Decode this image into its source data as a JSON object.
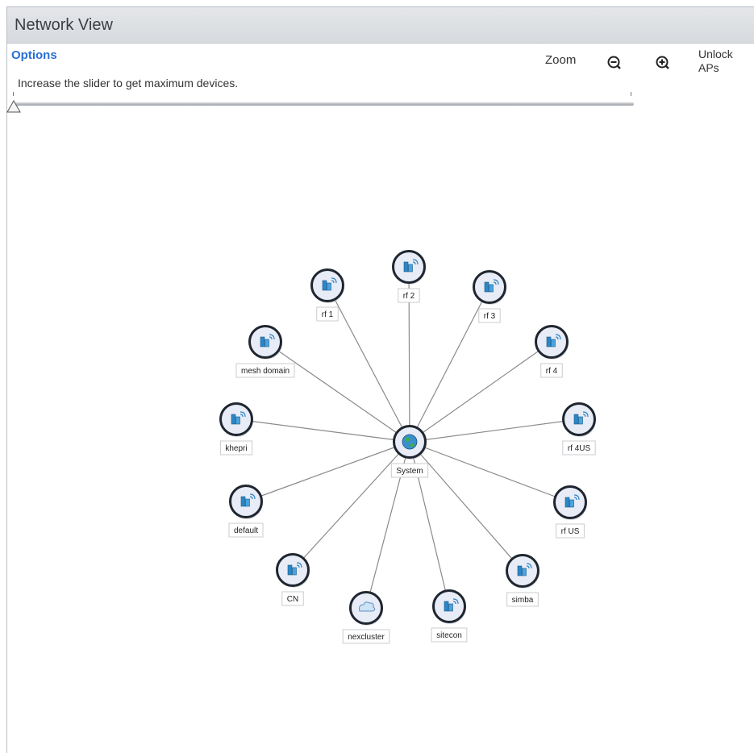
{
  "panel": {
    "title": "Network View"
  },
  "options": {
    "label": "Options",
    "hint": "Increase the slider to get maximum devices.",
    "slider_value_fraction": 0.0
  },
  "zoom": {
    "label": "Zoom",
    "zoom_out_icon": "zoom-out-icon",
    "zoom_in_icon": "zoom-in-icon"
  },
  "unlock": {
    "label": "Unlock APs"
  },
  "colors": {
    "title_text": "#3a3f45",
    "options_link": "#2a6fd3",
    "edge": "#8a8a8a",
    "node_fill": "#e8ecf6",
    "node_ring": "#1f2630"
  },
  "graph": {
    "center": {
      "label": "System",
      "icon": "globe-icon"
    },
    "nodes": [
      {
        "label": "rf 2",
        "icon": "access-point-icon"
      },
      {
        "label": "rf 3",
        "icon": "access-point-icon"
      },
      {
        "label": "rf 4",
        "icon": "access-point-icon"
      },
      {
        "label": "rf 4US",
        "icon": "access-point-icon"
      },
      {
        "label": "rf US",
        "icon": "access-point-icon"
      },
      {
        "label": "simba",
        "icon": "access-point-icon"
      },
      {
        "label": "sitecon",
        "icon": "access-point-icon"
      },
      {
        "label": "nexcluster",
        "icon": "cluster-icon"
      },
      {
        "label": "CN",
        "icon": "access-point-icon"
      },
      {
        "label": "default",
        "icon": "access-point-icon"
      },
      {
        "label": "khepri",
        "icon": "access-point-icon"
      },
      {
        "label": "mesh domain",
        "icon": "access-point-icon"
      },
      {
        "label": "rf 1",
        "icon": "access-point-icon"
      }
    ]
  }
}
